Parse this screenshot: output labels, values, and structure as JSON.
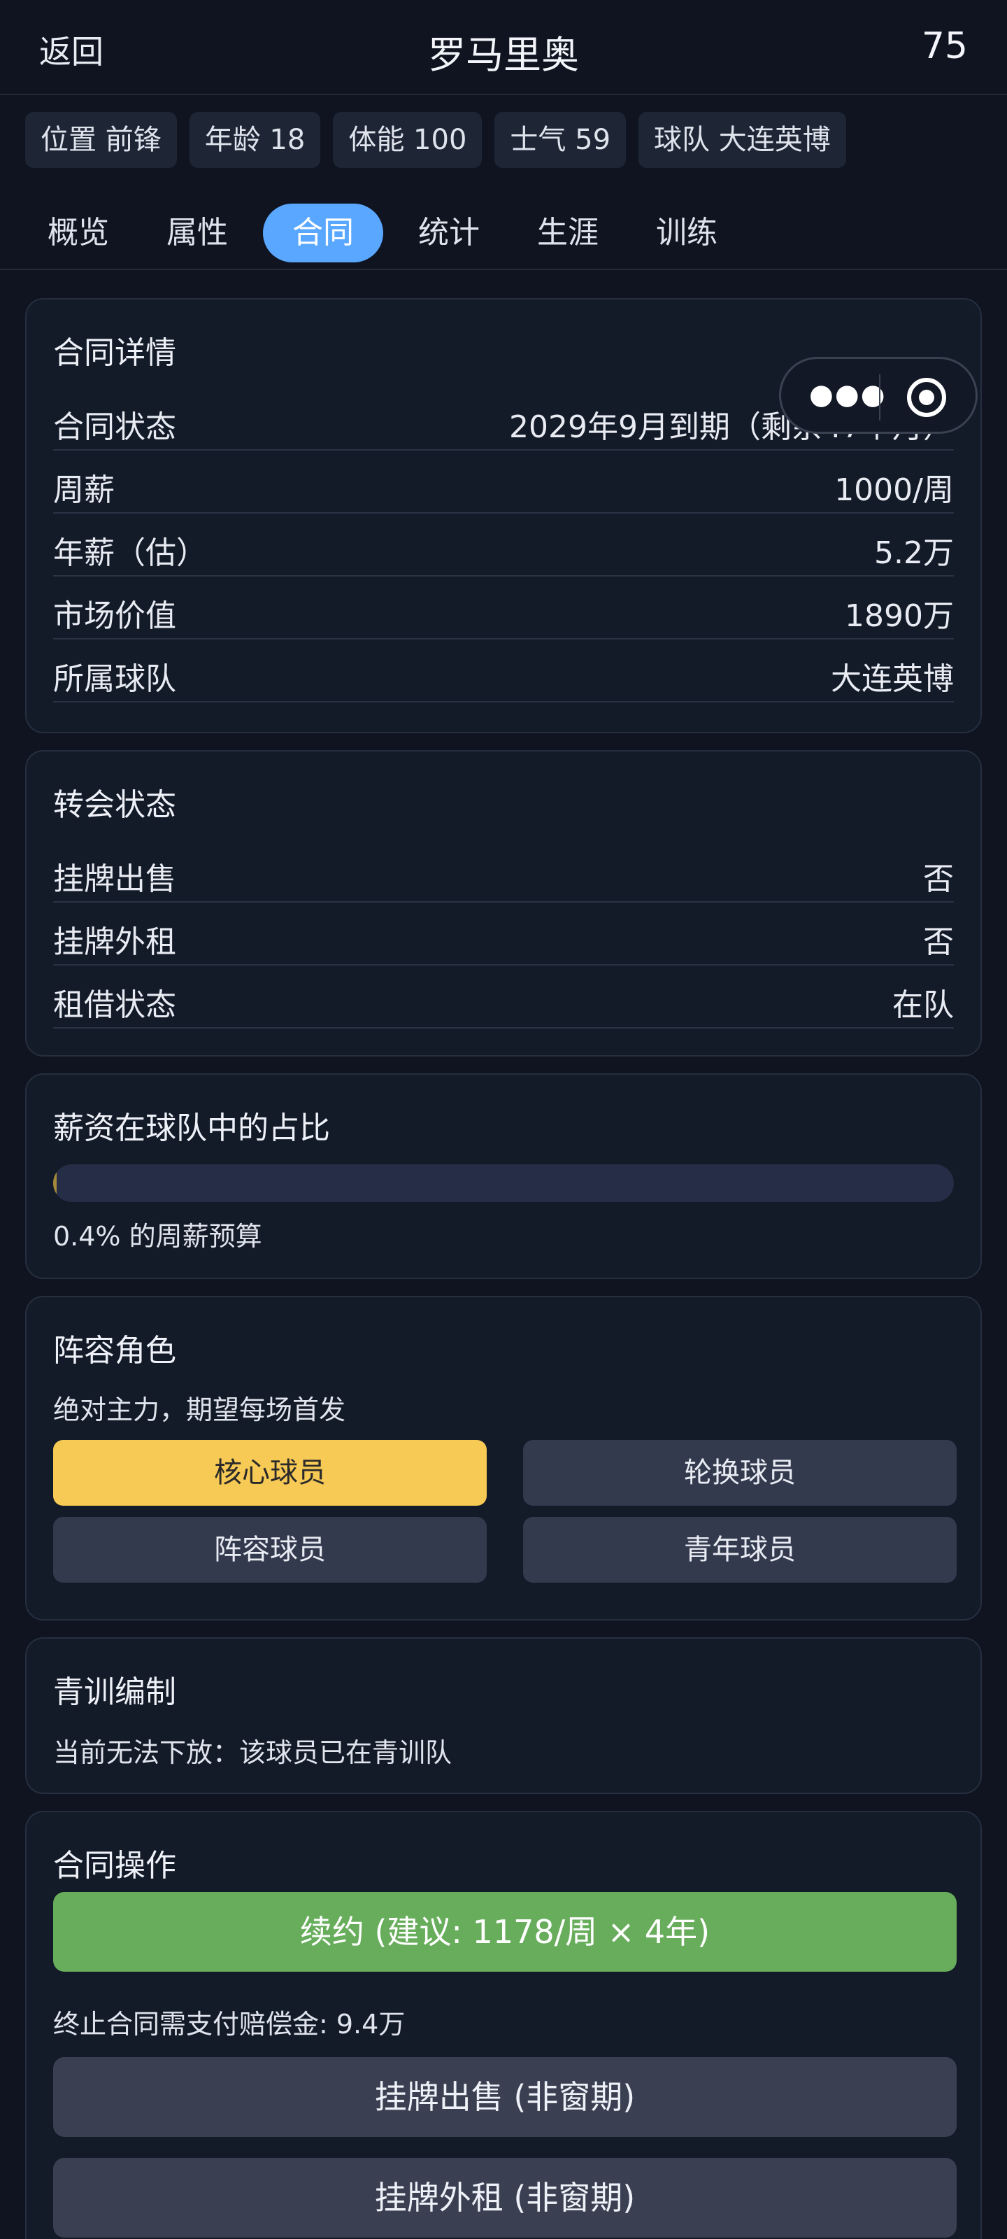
{
  "header": {
    "back_label": "返回",
    "title": "罗马里奥",
    "rating": "75"
  },
  "chips": [
    {
      "label": "位置 前锋"
    },
    {
      "label": "年龄 18"
    },
    {
      "label": "体能 100"
    },
    {
      "label": "士气 59"
    },
    {
      "label": "球队 大连英博"
    }
  ],
  "tabs": [
    {
      "label": "概览"
    },
    {
      "label": "属性"
    },
    {
      "label": "合同",
      "active": true
    },
    {
      "label": "统计"
    },
    {
      "label": "生涯"
    },
    {
      "label": "训练"
    }
  ],
  "contract_details": {
    "title": "合同详情",
    "rows": [
      {
        "label": "合同状态",
        "value": "2029年9月到期（剩余47个月）"
      },
      {
        "label": "周薪",
        "value": "1000/周"
      },
      {
        "label": "年薪（估）",
        "value": "5.2万"
      },
      {
        "label": "市场价值",
        "value": "1890万"
      },
      {
        "label": "所属球队",
        "value": "大连英博"
      }
    ]
  },
  "transfer_status": {
    "title": "转会状态",
    "rows": [
      {
        "label": "挂牌出售",
        "value": "否"
      },
      {
        "label": "挂牌外租",
        "value": "否"
      },
      {
        "label": "租借状态",
        "value": "在队"
      }
    ]
  },
  "salary_share": {
    "title": "薪资在球队中的占比",
    "percent": 0.4,
    "caption": "0.4% 的周薪预算",
    "fill_color": "#a58a3a"
  },
  "squad_role": {
    "title": "阵容角色",
    "description": "绝对主力，期望每场首发",
    "options": [
      {
        "label": "核心球员",
        "selected": true
      },
      {
        "label": "轮换球员",
        "selected": false
      },
      {
        "label": "阵容球员",
        "selected": false
      },
      {
        "label": "青年球员",
        "selected": false
      }
    ],
    "selected_color": "#f7c955"
  },
  "youth": {
    "title": "青训编制",
    "text": "当前无法下放：该球员已在青训队"
  },
  "contract_actions": {
    "title": "合同操作",
    "renew_label": "续约 (建议: 1178/周 × 4年)",
    "termination_text": "终止合同需支付赔偿金: 9.4万",
    "list_sale_label": "挂牌出售 (非窗期)",
    "list_loan_label": "挂牌外租 (非窗期)",
    "renew_color": "#67ad5b"
  },
  "icons": {
    "more": "more-dots-icon",
    "close": "target-circle-icon"
  }
}
